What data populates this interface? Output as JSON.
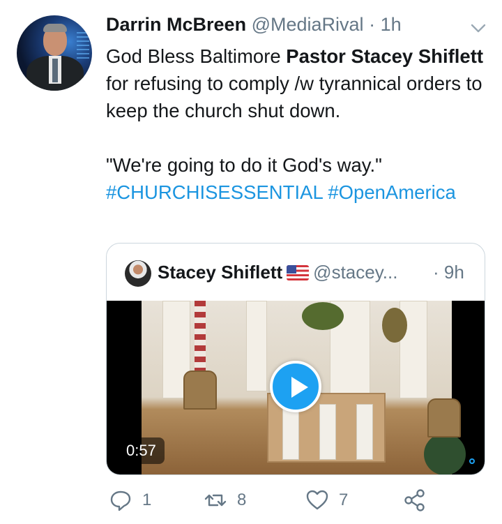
{
  "tweet": {
    "author": "Darrin McBreen",
    "handle": "@MediaRival",
    "separator": "·",
    "time": "1h",
    "text": {
      "line1_prefix": "God Bless Baltimore ",
      "bold_name": "Pastor Stacey Shiflett",
      "line_rest": " for refusing to comply /w tyrannical orders to keep the church shut down.",
      "quote_line": "\"We're going to do it God's way.\"",
      "hashtags": [
        "#CHURCHISESSENTIAL",
        "#OpenAmerica"
      ]
    }
  },
  "quoted": {
    "name": "Stacey Shiflett",
    "handle": "@stacey...",
    "time": "· 9h",
    "video": {
      "duration": "0:57"
    }
  },
  "actions": {
    "reply_count": "1",
    "retweet_count": "8",
    "like_count": "7"
  },
  "icons": {
    "chevron": "chevron-down-icon",
    "reply": "reply-icon",
    "retweet": "retweet-icon",
    "like": "heart-icon",
    "share": "share-icon",
    "play": "play-icon",
    "flag": "us-flag-icon"
  },
  "colors": {
    "accent": "#1da1f2",
    "hashtag": "#1b95e0",
    "muted": "#657786",
    "text": "#14171a"
  }
}
